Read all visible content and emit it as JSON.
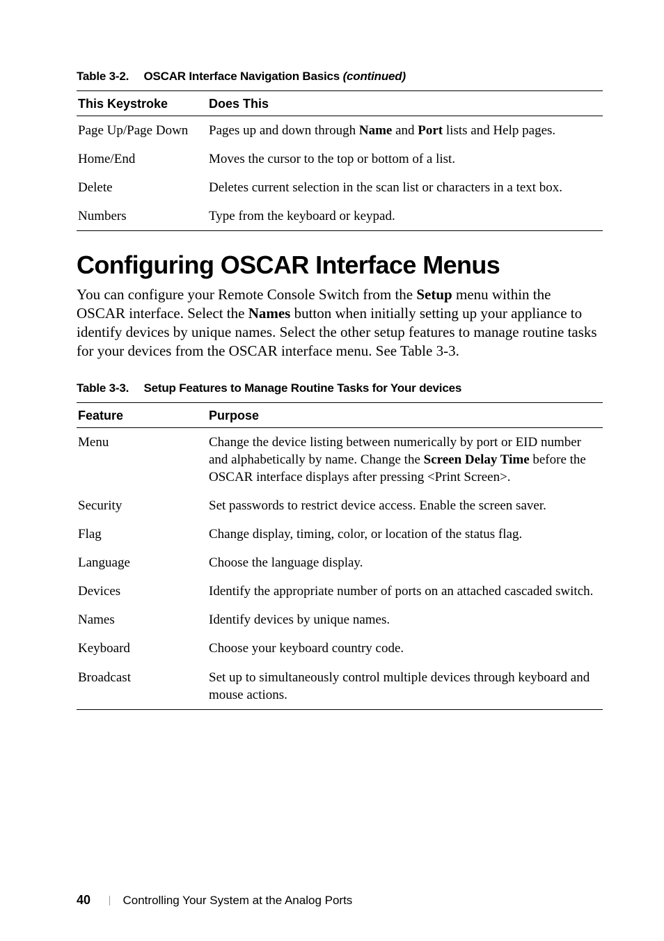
{
  "captions": {
    "t32_prefix": "Table 3-2.  OSCAR Interface Navigation Basics ",
    "t32_suffix": "(continued)",
    "t33": "Table 3-3.  Setup Features to Manage Routine Tasks for Your devices"
  },
  "table32": {
    "head": {
      "c0": "This Keystroke",
      "c1": "Does This"
    },
    "rows": [
      {
        "c0": "Page Up/Page Down",
        "c1_a": "Pages up and down through ",
        "c1_b": "Name",
        "c1_c": " and ",
        "c1_d": "Port",
        "c1_e": " lists and Help pages."
      },
      {
        "c0": "Home/End",
        "c1": "Moves the cursor to the top or bottom of a list."
      },
      {
        "c0": "Delete",
        "c1": "Deletes current selection in the scan list or characters in a text box."
      },
      {
        "c0": "Numbers",
        "c1": "Type from the keyboard or keypad."
      }
    ]
  },
  "heading": "Configuring OSCAR Interface Menus",
  "para": {
    "a": "You can configure your Remote Console Switch from the ",
    "b": "Setup",
    "c": " menu within the OSCAR interface. Select the ",
    "d": "Names",
    "e": " button when initially setting up your appliance to identify devices by unique names. Select the other setup features to manage routine tasks for your devices from the OSCAR interface menu. See Table 3-3."
  },
  "table33": {
    "head": {
      "c0": "Feature",
      "c1": "Purpose"
    },
    "rows": [
      {
        "c0": "Menu",
        "c1_a": "Change the device listing between numerically by port or EID number and alphabetically by name. Change the ",
        "c1_b": "Screen Delay Time",
        "c1_c": " before the OSCAR interface displays after pressing <Print Screen>."
      },
      {
        "c0": "Security",
        "c1": "Set passwords to restrict device access. Enable the screen saver."
      },
      {
        "c0": "Flag",
        "c1": "Change display, timing, color, or location of the status flag."
      },
      {
        "c0": "Language",
        "c1": "Choose the language display."
      },
      {
        "c0": "Devices",
        "c1": "Identify the appropriate number of ports on an attached cascaded switch."
      },
      {
        "c0": "Names",
        "c1": "Identify devices by unique names."
      },
      {
        "c0": "Keyboard",
        "c1": "Choose your keyboard country code."
      },
      {
        "c0": "Broadcast",
        "c1": "Set up to simultaneously control multiple devices through keyboard and\nmouse actions."
      }
    ]
  },
  "footer": {
    "page": "40",
    "title": "Controlling Your System at the Analog Ports"
  },
  "chart_data": [
    {
      "type": "table",
      "title": "Table 3-2. OSCAR Interface Navigation Basics (continued)",
      "columns": [
        "This Keystroke",
        "Does This"
      ],
      "rows": [
        [
          "Page Up/Page Down",
          "Pages up and down through Name and Port lists and Help pages."
        ],
        [
          "Home/End",
          "Moves the cursor to the top or bottom of a list."
        ],
        [
          "Delete",
          "Deletes current selection in the scan list or characters in a text box."
        ],
        [
          "Numbers",
          "Type from the keyboard or keypad."
        ]
      ]
    },
    {
      "type": "table",
      "title": "Table 3-3. Setup Features to Manage Routine Tasks for Your devices",
      "columns": [
        "Feature",
        "Purpose"
      ],
      "rows": [
        [
          "Menu",
          "Change the device listing between numerically by port or EID number and alphabetically by name. Change the Screen Delay Time before the OSCAR interface displays after pressing <Print Screen>."
        ],
        [
          "Security",
          "Set passwords to restrict device access. Enable the screen saver."
        ],
        [
          "Flag",
          "Change display, timing, color, or location of the status flag."
        ],
        [
          "Language",
          "Choose the language display."
        ],
        [
          "Devices",
          "Identify the appropriate number of ports on an attached cascaded switch."
        ],
        [
          "Names",
          "Identify devices by unique names."
        ],
        [
          "Keyboard",
          "Choose your keyboard country code."
        ],
        [
          "Broadcast",
          "Set up to simultaneously control multiple devices through keyboard and mouse actions."
        ]
      ]
    }
  ]
}
